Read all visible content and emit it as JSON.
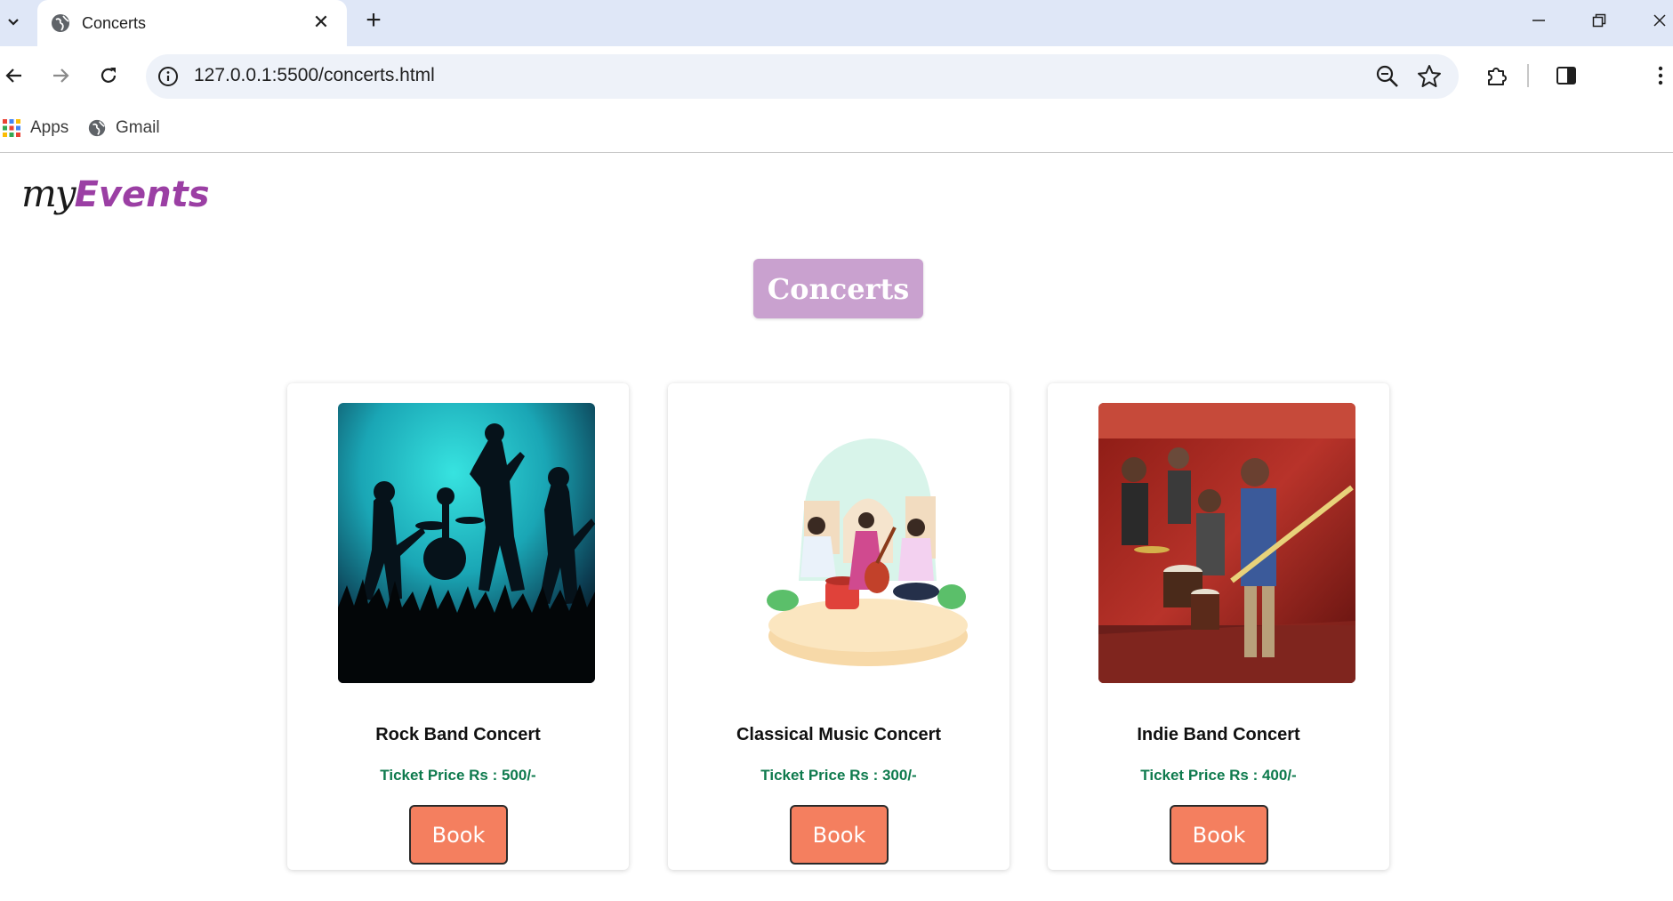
{
  "browser": {
    "tab_title": "Concerts",
    "url": "127.0.0.1:5500/concerts.html",
    "bookmarks": [
      {
        "label": "Apps",
        "icon": "apps-grid-icon"
      },
      {
        "label": "Gmail",
        "icon": "globe-icon"
      }
    ]
  },
  "site": {
    "logo_my": "my",
    "logo_events": "Events",
    "brand_color": "#9b3fa4"
  },
  "page": {
    "heading": "Concerts",
    "heading_bg": "#c9a1cf",
    "button_color": "#f47f5f",
    "price_color": "#0e7a4d"
  },
  "concerts": [
    {
      "name": "Rock Band Concert",
      "price": "Ticket Price Rs : 500/-",
      "book_label": "Book",
      "image": "rock-band-silhouette-image"
    },
    {
      "name": "Classical Music Concert",
      "price": "Ticket Price Rs : 300/-",
      "book_label": "Book",
      "image": "classical-musicians-illustration-image"
    },
    {
      "name": "Indie Band Concert",
      "price": "Ticket Price Rs : 400/-",
      "book_label": "Book",
      "image": "indie-band-photo-image"
    }
  ]
}
